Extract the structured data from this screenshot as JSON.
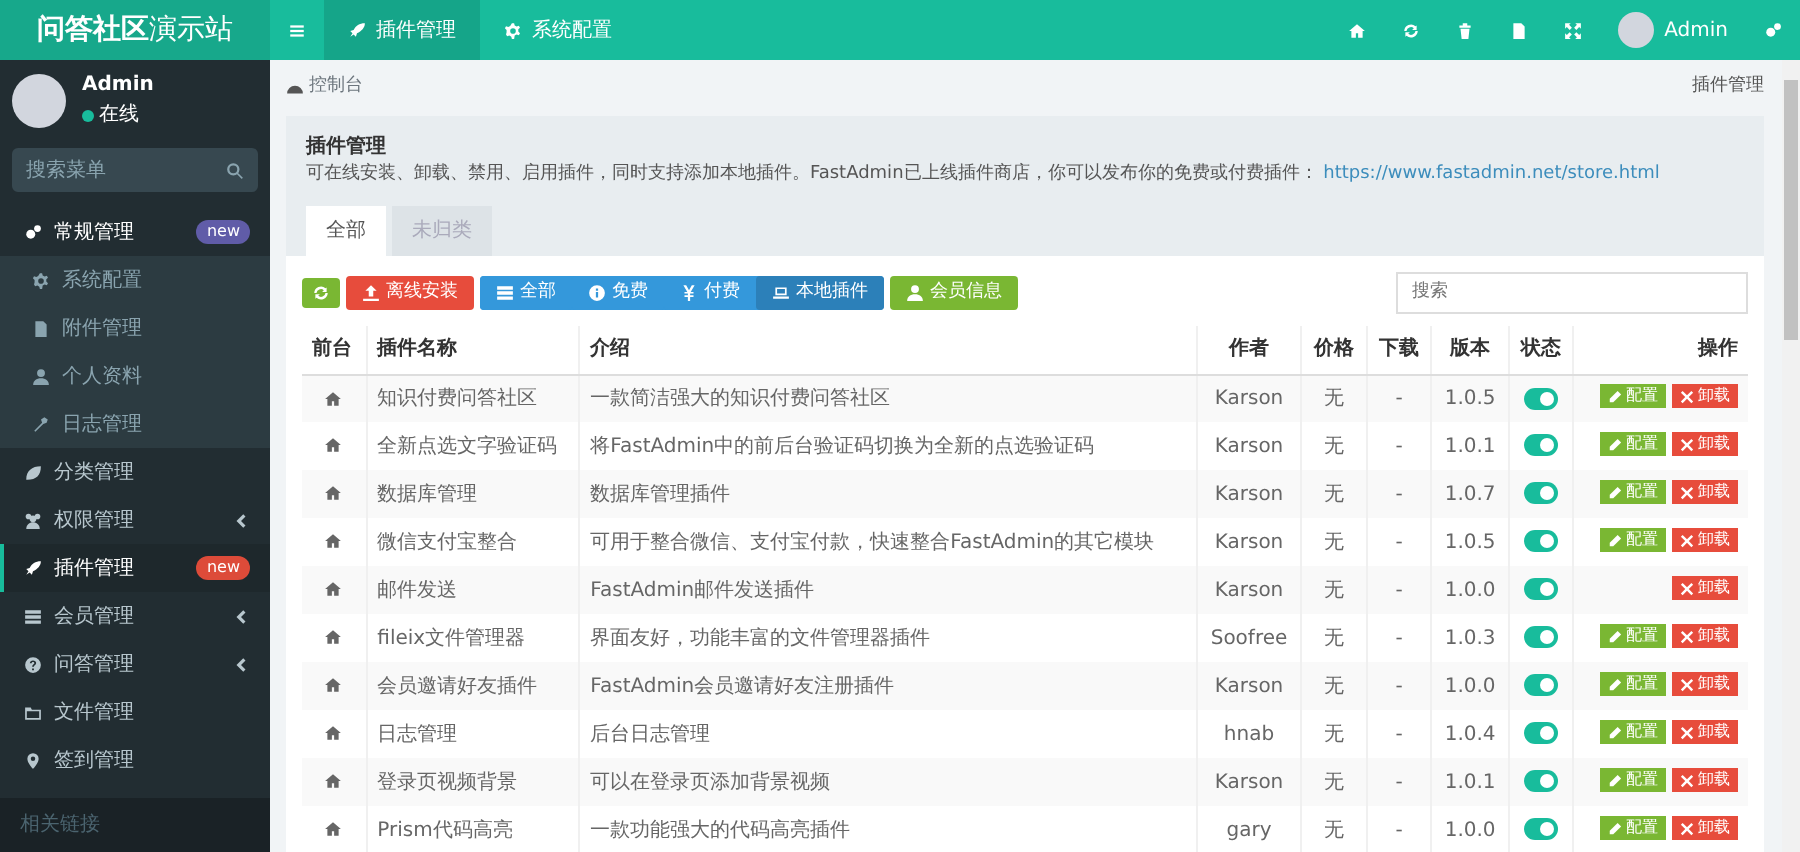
{
  "header": {
    "logo_bold": "问答社区",
    "logo_light": "演示站",
    "tabs": [
      {
        "label": "插件管理",
        "selected": true
      },
      {
        "label": "系统配置",
        "selected": false
      }
    ],
    "user": "Admin"
  },
  "sidebar": {
    "user": {
      "name": "Admin",
      "status": "在线"
    },
    "search": {
      "placeholder": "搜索菜单"
    },
    "items": [
      {
        "label": "常规管理",
        "kind": "group",
        "expanded": true,
        "selected": false,
        "badge": {
          "text": "new",
          "color": "#605ca8"
        },
        "children": [
          {
            "label": "系统配置",
            "selected": false
          },
          {
            "label": "附件管理",
            "selected": false
          },
          {
            "label": "个人资料",
            "selected": false
          },
          {
            "label": "日志管理",
            "selected": false
          }
        ]
      },
      {
        "label": "分类管理",
        "kind": "link",
        "selected": false
      },
      {
        "label": "权限管理",
        "kind": "group",
        "expanded": false,
        "selected": false
      },
      {
        "label": "插件管理",
        "kind": "link",
        "selected": true,
        "badge": {
          "text": "new",
          "color": "#dd4b39"
        }
      },
      {
        "label": "会员管理",
        "kind": "group",
        "expanded": false,
        "selected": false
      },
      {
        "label": "问答管理",
        "kind": "group",
        "expanded": false,
        "selected": false
      },
      {
        "label": "文件管理",
        "kind": "link",
        "selected": false
      },
      {
        "label": "签到管理",
        "kind": "link",
        "selected": false
      }
    ],
    "section": "相关链接"
  },
  "breadcrumb": {
    "home": "控制台",
    "current": "插件管理"
  },
  "panel": {
    "title": "插件管理",
    "description": "可在线安装、卸载、禁用、启用插件，同时支持添加本地插件。FastAdmin已上线插件商店，你可以发布你的免费或付费插件：",
    "link": "https://www.fastadmin.net/store.html",
    "tabs": [
      {
        "label": "全部",
        "selected": true
      },
      {
        "label": "未归类",
        "selected": false
      }
    ]
  },
  "toolbar": {
    "offline_install": "离线安装",
    "filters": [
      {
        "label": "全部",
        "selected": false
      },
      {
        "label": "免费",
        "selected": false
      },
      {
        "label": "付费",
        "selected": false
      },
      {
        "label": "本地插件",
        "selected": true
      }
    ],
    "member_info": "会员信息",
    "search": {
      "placeholder": "搜索"
    }
  },
  "table": {
    "columns": [
      "前台",
      "插件名称",
      "介绍",
      "作者",
      "价格",
      "下载",
      "版本",
      "状态",
      "操作"
    ],
    "rows": [
      {
        "name": "知识付费问答社区",
        "description": "一款简洁强大的知识付费问答社区",
        "author": "Karson",
        "price": "无",
        "downloads": "-",
        "version": "1.0.5",
        "enabled": true,
        "buttons": [
          {
            "kind": "config",
            "label": "配置"
          },
          {
            "kind": "uninstall",
            "label": "卸载"
          }
        ]
      },
      {
        "name": "全新点选文字验证码",
        "description": "将FastAdmin中的前后台验证码切换为全新的点选验证码",
        "author": "Karson",
        "price": "无",
        "downloads": "-",
        "version": "1.0.1",
        "enabled": true,
        "buttons": [
          {
            "kind": "config",
            "label": "配置"
          },
          {
            "kind": "uninstall",
            "label": "卸载"
          }
        ]
      },
      {
        "name": "数据库管理",
        "description": "数据库管理插件",
        "author": "Karson",
        "price": "无",
        "downloads": "-",
        "version": "1.0.7",
        "enabled": true,
        "buttons": [
          {
            "kind": "config",
            "label": "配置"
          },
          {
            "kind": "uninstall",
            "label": "卸载"
          }
        ]
      },
      {
        "name": "微信支付宝整合",
        "description": "可用于整合微信、支付宝付款，快速整合FastAdmin的其它模块",
        "author": "Karson",
        "price": "无",
        "downloads": "-",
        "version": "1.0.5",
        "enabled": true,
        "buttons": [
          {
            "kind": "config",
            "label": "配置"
          },
          {
            "kind": "uninstall",
            "label": "卸载"
          }
        ]
      },
      {
        "name": "邮件发送",
        "description": "FastAdmin邮件发送插件",
        "author": "Karson",
        "price": "无",
        "downloads": "-",
        "version": "1.0.0",
        "enabled": true,
        "buttons": [
          {
            "kind": "uninstall",
            "label": "卸载"
          }
        ]
      },
      {
        "name": "fileix文件管理器",
        "description": "界面友好，功能丰富的文件管理器插件",
        "author": "Soofree",
        "price": "无",
        "downloads": "-",
        "version": "1.0.3",
        "enabled": true,
        "buttons": [
          {
            "kind": "config",
            "label": "配置"
          },
          {
            "kind": "uninstall",
            "label": "卸载"
          }
        ]
      },
      {
        "name": "会员邀请好友插件",
        "description": "FastAdmin会员邀请好友注册插件",
        "author": "Karson",
        "price": "无",
        "downloads": "-",
        "version": "1.0.0",
        "enabled": true,
        "buttons": [
          {
            "kind": "config",
            "label": "配置"
          },
          {
            "kind": "uninstall",
            "label": "卸载"
          }
        ]
      },
      {
        "name": "日志管理",
        "description": "后台日志管理",
        "author": "hnab",
        "price": "无",
        "downloads": "-",
        "version": "1.0.4",
        "enabled": true,
        "buttons": [
          {
            "kind": "config",
            "label": "配置"
          },
          {
            "kind": "uninstall",
            "label": "卸载"
          }
        ]
      },
      {
        "name": "登录页视频背景",
        "description": "可以在登录页添加背景视频",
        "author": "Karson",
        "price": "无",
        "downloads": "-",
        "version": "1.0.1",
        "enabled": true,
        "buttons": [
          {
            "kind": "config",
            "label": "配置"
          },
          {
            "kind": "uninstall",
            "label": "卸载"
          }
        ]
      },
      {
        "name": "Prism代码高亮",
        "description": "一款功能强大的代码高亮插件",
        "author": "gary",
        "price": "无",
        "downloads": "-",
        "version": "1.0.0",
        "enabled": true,
        "buttons": [
          {
            "kind": "config",
            "label": "配置"
          },
          {
            "kind": "uninstall",
            "label": "卸载"
          }
        ]
      }
    ]
  }
}
